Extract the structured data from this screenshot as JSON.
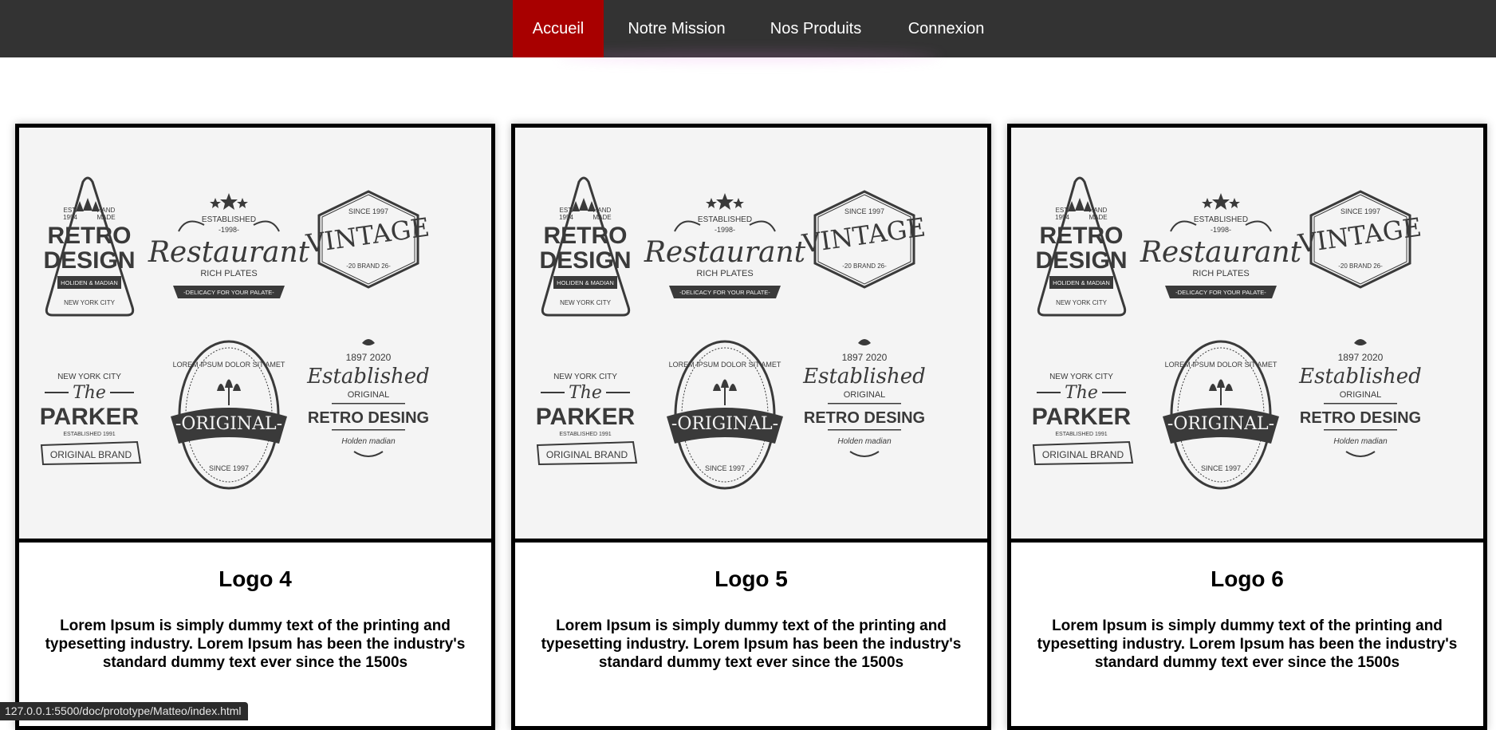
{
  "nav": {
    "items": [
      {
        "label": "Accueil",
        "active": true
      },
      {
        "label": "Notre Mission",
        "active": false
      },
      {
        "label": "Nos Produits",
        "active": false
      },
      {
        "label": "Connexion",
        "active": false
      }
    ],
    "background": "#333333",
    "active_color": "#a80000"
  },
  "cards": [
    {
      "title": "Logo 4",
      "description": "Lorem Ipsum is simply dummy text of the printing and typesetting industry. Lorem Ipsum has been the industry's standard dummy text ever since the 1500s"
    },
    {
      "title": "Logo 5",
      "description": "Lorem Ipsum is simply dummy text of the printing and typesetting industry. Lorem Ipsum has been the industry's standard dummy text ever since the 1500s"
    },
    {
      "title": "Logo 6",
      "description": "Lorem Ipsum is simply dummy text of the printing and typesetting industry. Lorem Ipsum has been the industry's standard dummy text ever since the 1500s"
    }
  ],
  "logo_sheet": {
    "retro": {
      "est": "EST.",
      "year": "1954",
      "hand": "HAND",
      "made": "MADE",
      "line1": "RETRO",
      "line2": "DESIGN",
      "ribbon": "HOLIDEN & MADIAN",
      "city": "NEW YORK CITY"
    },
    "restaurant": {
      "established": "ESTABLISHED",
      "year": "-1998-",
      "name": "Restaurant",
      "sub": "RICH PLATES",
      "ribbon": "-DELICACY FOR YOUR PALATE-"
    },
    "vintage": {
      "since": "SINCE 1997",
      "name": "VINTAGE",
      "sub": "-20 BRAND 26-"
    },
    "parker": {
      "city": "NEW YORK CITY",
      "the": "The",
      "name": "PARKER",
      "est": "ESTABLISHED 1991",
      "ribbon": "ORIGINAL BRAND"
    },
    "original": {
      "ring": "LOREM IPSUM DOLOR SIT AMET",
      "ribbon": "-ORIGINAL-",
      "since": "SINCE 1997"
    },
    "established": {
      "years": "1897   2020",
      "script": "Established",
      "original": "ORIGINAL",
      "name": "RETRO DESING",
      "footer": "Holden madian"
    }
  },
  "status_bar": {
    "url": "127.0.0.1:5500/doc/prototype/Matteo/index.html"
  }
}
